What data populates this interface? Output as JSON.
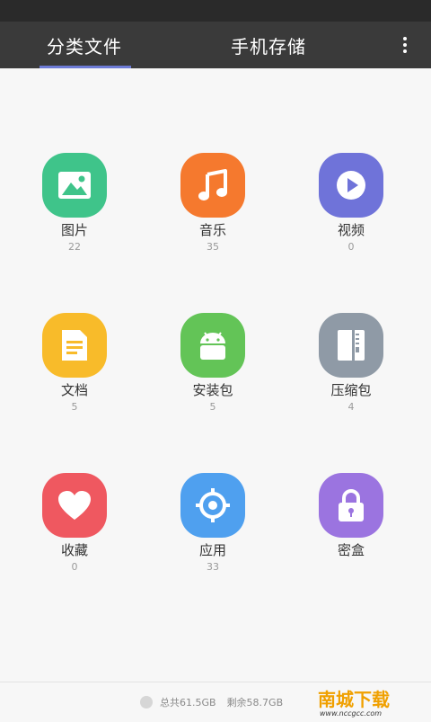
{
  "header": {
    "tabs": [
      {
        "label": "分类文件"
      },
      {
        "label": "手机存储"
      }
    ]
  },
  "categories": [
    {
      "label": "图片",
      "count": "22",
      "color": "#3fc48a",
      "icon": "image-icon"
    },
    {
      "label": "音乐",
      "count": "35",
      "color": "#f5792e",
      "icon": "music-note-icon"
    },
    {
      "label": "视频",
      "count": "0",
      "color": "#6f73d9",
      "icon": "video-play-icon"
    },
    {
      "label": "文档",
      "count": "5",
      "color": "#f8bb2a",
      "icon": "document-icon"
    },
    {
      "label": "安装包",
      "count": "5",
      "color": "#63c457",
      "icon": "android-icon"
    },
    {
      "label": "压缩包",
      "count": "4",
      "color": "#8f9aa6",
      "icon": "zip-archive-icon"
    },
    {
      "label": "收藏",
      "count": "0",
      "color": "#ef5860",
      "icon": "heart-icon"
    },
    {
      "label": "应用",
      "count": "33",
      "color": "#4fa0ef",
      "icon": "app-gear-icon"
    },
    {
      "label": "密盒",
      "count": "",
      "color": "#9b74e0",
      "icon": "lock-icon"
    }
  ],
  "footer": {
    "total": "总共61.5GB",
    "free": "剩余58.7GB"
  },
  "watermark": {
    "text": "南城下载",
    "url_text": "www.nccgcc.com"
  }
}
